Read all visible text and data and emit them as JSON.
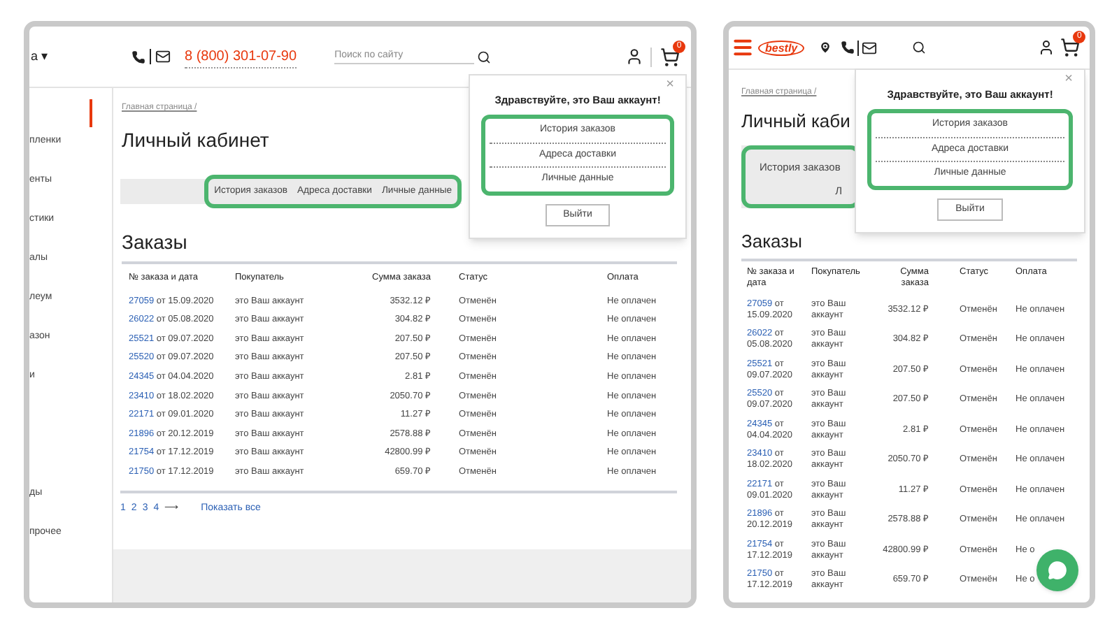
{
  "desktop": {
    "header": {
      "menu_label": "а",
      "menu_caret": "▾",
      "phone": "8 (800) 301-07-90",
      "search": {
        "placeholder": "Поиск по сайту"
      },
      "cart_count": "0"
    },
    "sidebar": {
      "items": [
        "пленки",
        "енты",
        "стики",
        "алы",
        "леум",
        "азон",
        "и",
        "ды",
        "прочее"
      ]
    },
    "breadcrumb": "Главная страница /",
    "title": "Личный кабинет",
    "tabs": [
      "История заказов",
      "Адреса доставки",
      "Личные данные"
    ],
    "section_title": "Заказы",
    "table": {
      "columns": [
        "№ заказа и дата",
        "Покупатель",
        "Сумма заказа",
        "Статус",
        "Оплата"
      ],
      "rows": [
        {
          "number": "27059",
          "date": "от 15.09.2020",
          "buyer": "это Ваш аккаунт",
          "sum": "3532.12 ₽",
          "status": "Отменён",
          "payment": "Не оплачен"
        },
        {
          "number": "26022",
          "date": "от 05.08.2020",
          "buyer": "это Ваш аккаунт",
          "sum": "304.82 ₽",
          "status": "Отменён",
          "payment": "Не оплачен"
        },
        {
          "number": "25521",
          "date": "от 09.07.2020",
          "buyer": "это Ваш аккаунт",
          "sum": "207.50 ₽",
          "status": "Отменён",
          "payment": "Не оплачен"
        },
        {
          "number": "25520",
          "date": "от 09.07.2020",
          "buyer": "это Ваш аккаунт",
          "sum": "207.50 ₽",
          "status": "Отменён",
          "payment": "Не оплачен"
        },
        {
          "number": "24345",
          "date": "от 04.04.2020",
          "buyer": "это Ваш аккаунт",
          "sum": "2.81 ₽",
          "status": "Отменён",
          "payment": "Не оплачен"
        },
        {
          "number": "23410",
          "date": "от 18.02.2020",
          "buyer": "это Ваш аккаунт",
          "sum": "2050.70 ₽",
          "status": "Отменён",
          "payment": "Не оплачен"
        },
        {
          "number": "22171",
          "date": "от 09.01.2020",
          "buyer": "это Ваш аккаунт",
          "sum": "11.27 ₽",
          "status": "Отменён",
          "payment": "Не оплачен"
        },
        {
          "number": "21896",
          "date": "от 20.12.2019",
          "buyer": "это Ваш аккаунт",
          "sum": "2578.88 ₽",
          "status": "Отменён",
          "payment": "Не оплачен"
        },
        {
          "number": "21754",
          "date": "от 17.12.2019",
          "buyer": "это Ваш аккаунт",
          "sum": "42800.99 ₽",
          "status": "Отменён",
          "payment": "Не оплачен"
        },
        {
          "number": "21750",
          "date": "от 17.12.2019",
          "buyer": "это Ваш аккаунт",
          "sum": "659.70 ₽",
          "status": "Отменён",
          "payment": "Не оплачен"
        }
      ]
    },
    "pagination": {
      "pages": [
        "1",
        "2",
        "3",
        "4"
      ],
      "next": "⟶",
      "show_all": "Показать все"
    },
    "popup": {
      "close": "×",
      "greeting": "Здравствуйте, это Ваш аккаунт!",
      "links": [
        "История заказов",
        "Адреса доставки",
        "Личные данные"
      ],
      "logout": "Выйти"
    }
  },
  "mobile": {
    "header": {
      "logo": "bestly",
      "cart_count": "0"
    },
    "breadcrumb": "Главная страница /",
    "title": "Личный каби",
    "tabs": [
      "История заказов",
      "Л"
    ],
    "popup": {
      "close": "×",
      "greeting": "Здравствуйте, это Ваш аккаунт!",
      "links": [
        "История заказов",
        "Адреса доставки",
        "Личные данные"
      ],
      "logout": "Выйти"
    },
    "section_title": "Заказы",
    "table": {
      "columns": [
        "№ заказа и дата",
        "Покупатель",
        "Сумма заказа",
        "Статус",
        "Оплата"
      ],
      "rows": [
        {
          "number": "27059",
          "date": "от 15.09.2020",
          "buyer": "это Ваш аккаунт",
          "sum": "3532.12 ₽",
          "status": "Отменён",
          "payment": "Не оплачен"
        },
        {
          "number": "26022",
          "date": "от 05.08.2020",
          "buyer": "это Ваш аккаунт",
          "sum": "304.82 ₽",
          "status": "Отменён",
          "payment": "Не оплачен"
        },
        {
          "number": "25521",
          "date": "от 09.07.2020",
          "buyer": "это Ваш аккаунт",
          "sum": "207.50 ₽",
          "status": "Отменён",
          "payment": "Не оплачен"
        },
        {
          "number": "25520",
          "date": "от 09.07.2020",
          "buyer": "это Ваш аккаунт",
          "sum": "207.50 ₽",
          "status": "Отменён",
          "payment": "Не оплачен"
        },
        {
          "number": "24345",
          "date": "от 04.04.2020",
          "buyer": "это Ваш аккаунт",
          "sum": "2.81 ₽",
          "status": "Отменён",
          "payment": "Не оплачен"
        },
        {
          "number": "23410",
          "date": "от 18.02.2020",
          "buyer": "это Ваш аккаунт",
          "sum": "2050.70 ₽",
          "status": "Отменён",
          "payment": "Не оплачен"
        },
        {
          "number": "22171",
          "date": "от 09.01.2020",
          "buyer": "это Ваш аккаунт",
          "sum": "11.27 ₽",
          "status": "Отменён",
          "payment": "Не оплачен"
        },
        {
          "number": "21896",
          "date": "от 20.12.2019",
          "buyer": "это Ваш аккаунт",
          "sum": "2578.88 ₽",
          "status": "Отменён",
          "payment": "Не оплачен"
        },
        {
          "number": "21754",
          "date": "от 17.12.2019",
          "buyer": "это Ваш аккаунт",
          "sum": "42800.99 ₽",
          "status": "Отменён",
          "payment": "Не о"
        },
        {
          "number": "21750",
          "date": "от 17.12.2019",
          "buyer": "это Ваш аккаунт",
          "sum": "659.70 ₽",
          "status": "Отменён",
          "payment": "Не о"
        }
      ]
    }
  }
}
